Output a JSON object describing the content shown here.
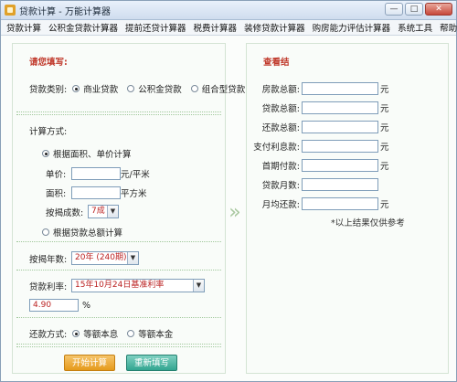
{
  "window": {
    "title": "贷款计算 - 万能计算器",
    "buttons": {
      "minimize": "—",
      "maximize": "□",
      "close": "✕"
    }
  },
  "menu": [
    "贷款计算",
    "公积金贷款计算器",
    "提前还贷计算器",
    "税费计算器",
    "装修贷款计算器",
    "购房能力评估计算器",
    "系统工具",
    "帮助(H)"
  ],
  "left": {
    "heading": "请您填写:",
    "loan_type_label": "贷款类别:",
    "loan_types": [
      "商业贷款",
      "公积金贷款",
      "组合型贷款"
    ],
    "loan_type_selected": 0,
    "calc_method_label": "计算方式:",
    "method_area": "根据面积、单价计算",
    "unit_price_label": "单价:",
    "unit_price_value": "",
    "unit_price_unit": "元/平米",
    "area_label": "面积:",
    "area_value": "",
    "area_unit": "平方米",
    "ratio_label": "按揭成数:",
    "ratio_value": "7成",
    "method_total": "根据贷款总额计算",
    "years_label": "按揭年数:",
    "years_value": "20年 (240期)",
    "rate_label": "贷款利率:",
    "rate_select": "15年10月24日基准利率",
    "rate_value": "4.90",
    "rate_unit": "%",
    "repay_label": "还款方式:",
    "repay_options": [
      "等额本息",
      "等额本金"
    ],
    "repay_selected": 0,
    "btn_start": "开始计算",
    "btn_reset": "重新填写"
  },
  "right": {
    "heading": "查看结",
    "rows": [
      {
        "label": "房款总额:",
        "value": "",
        "unit": "元"
      },
      {
        "label": "贷款总额:",
        "value": "",
        "unit": "元"
      },
      {
        "label": "还款总额:",
        "value": "",
        "unit": "元"
      },
      {
        "label": "支付利息款:",
        "value": "",
        "unit": "元"
      },
      {
        "label": "首期付款:",
        "value": "",
        "unit": "元"
      },
      {
        "label": "贷款月数:",
        "value": "",
        "unit": ""
      },
      {
        "label": "月均还款:",
        "value": "",
        "unit": "元"
      }
    ],
    "note": "*以上结果仅供参考"
  }
}
